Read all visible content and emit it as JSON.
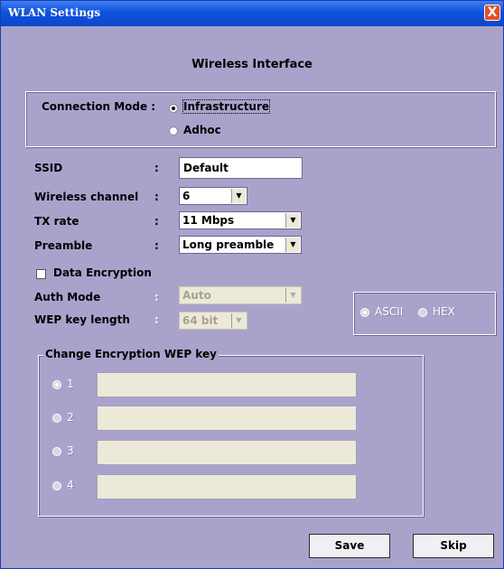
{
  "window": {
    "title": "WLAN Settings",
    "close_glyph": "X"
  },
  "heading": "Wireless Interface",
  "connection": {
    "label": "Connection Mode :",
    "options": [
      {
        "label": "Infrastructure",
        "checked": true
      },
      {
        "label": "Adhoc",
        "checked": false
      }
    ]
  },
  "ssid": {
    "label": "SSID",
    "colon": ":",
    "value": "Default"
  },
  "channel": {
    "label": "Wireless channel",
    "colon": ":",
    "value": "6"
  },
  "tx_rate": {
    "label": "TX rate",
    "colon": ":",
    "value": "11 Mbps"
  },
  "preamble": {
    "label": "Preamble",
    "colon": ":",
    "value": "Long preamble"
  },
  "encryption": {
    "label": "Data Encryption",
    "checked": false
  },
  "auth_mode": {
    "label": "Auth Mode",
    "colon": ":",
    "value": "Auto"
  },
  "wep_length": {
    "label": "WEP key length",
    "colon": ":",
    "value": "64 bit"
  },
  "key_format": {
    "options": [
      {
        "label": "ASCII",
        "checked": true
      },
      {
        "label": "HEX",
        "checked": false
      }
    ]
  },
  "wep_keys": {
    "legend": "Change Encryption WEP key",
    "keys": [
      {
        "label": "1",
        "value": "",
        "checked": true
      },
      {
        "label": "2",
        "value": "",
        "checked": false
      },
      {
        "label": "3",
        "value": "",
        "checked": false
      },
      {
        "label": "4",
        "value": "",
        "checked": false
      }
    ]
  },
  "buttons": {
    "save": "Save",
    "skip": "Skip"
  },
  "icons": {
    "dropdown": "chevron-down-icon",
    "close": "close-icon"
  },
  "colors": {
    "dialog_bg": "#a9a3cc",
    "titlebar": "#1152dd",
    "close": "#e0502a"
  }
}
